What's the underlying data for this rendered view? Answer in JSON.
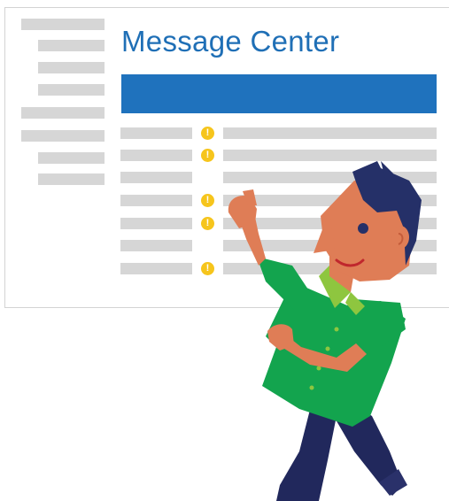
{
  "window": {
    "title": "Message Center"
  },
  "messages": [
    {
      "alert": true
    },
    {
      "alert": true
    },
    {
      "alert": false
    },
    {
      "alert": true
    },
    {
      "alert": true
    },
    {
      "alert": false
    },
    {
      "alert": true
    }
  ],
  "colors": {
    "title": "#1f6fb6",
    "header_bar": "#1f72bd",
    "placeholder_bar": "#d6d6d6",
    "alert_badge": "#f6c51c",
    "shirt": "#13a44e",
    "skin": "#df7d56",
    "hair": "#253068",
    "pants": "#21285c"
  },
  "icons": {
    "alert": "exclamation-circle-icon"
  }
}
